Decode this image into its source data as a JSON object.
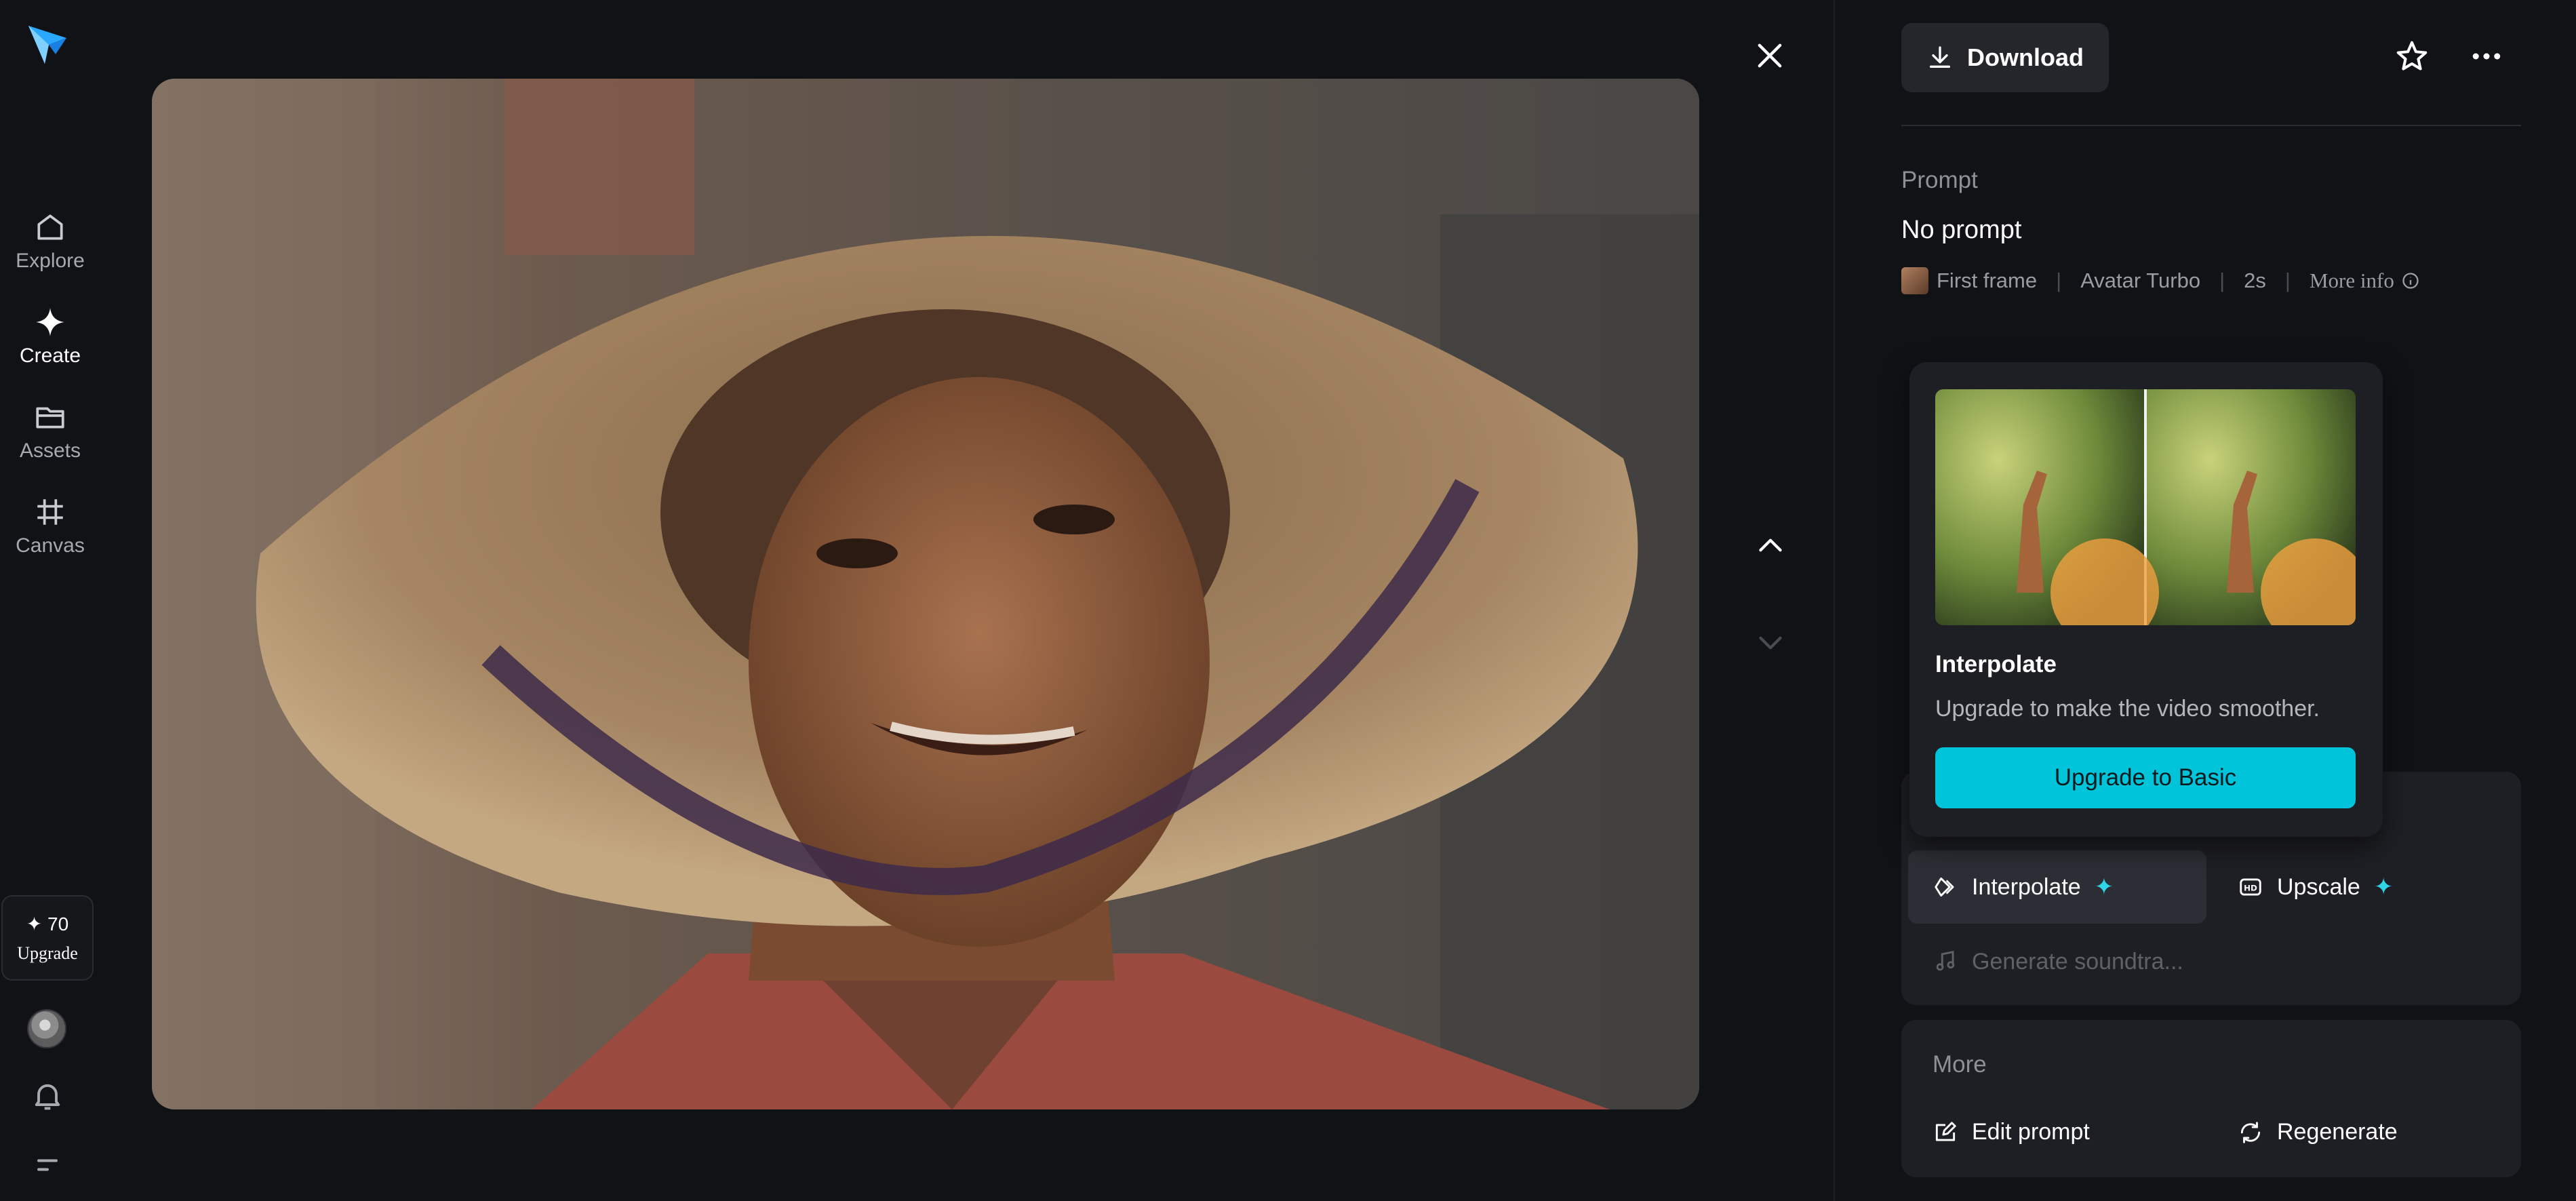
{
  "sidebar": {
    "items": [
      {
        "label": "Explore",
        "icon": "home-icon"
      },
      {
        "label": "Create",
        "icon": "sparkle-icon"
      },
      {
        "label": "Assets",
        "icon": "folder-icon"
      },
      {
        "label": "Canvas",
        "icon": "crop-grid-icon"
      }
    ],
    "credits": "✦ 70",
    "upgrade_label": "Upgrade"
  },
  "toolbar": {
    "download_label": "Download"
  },
  "prompt": {
    "label": "Prompt",
    "value": "No prompt",
    "meta": {
      "source": "First frame",
      "model": "Avatar Turbo",
      "duration": "2s",
      "more_info": "More info"
    }
  },
  "popover": {
    "title": "Interpolate",
    "description": "Upgrade to make the video smoother.",
    "button_label": "Upgrade to Basic"
  },
  "tools": {
    "interpolate_label": "Interpolate",
    "upscale_label": "Upscale",
    "soundtrack_label": "Generate soundtra..."
  },
  "more": {
    "title": "More",
    "edit_prompt_label": "Edit prompt",
    "regenerate_label": "Regenerate"
  },
  "colors": {
    "background": "#111216",
    "card": "#1e1f24",
    "accent": "#00c4d9",
    "spark": "#2fd6e6"
  }
}
